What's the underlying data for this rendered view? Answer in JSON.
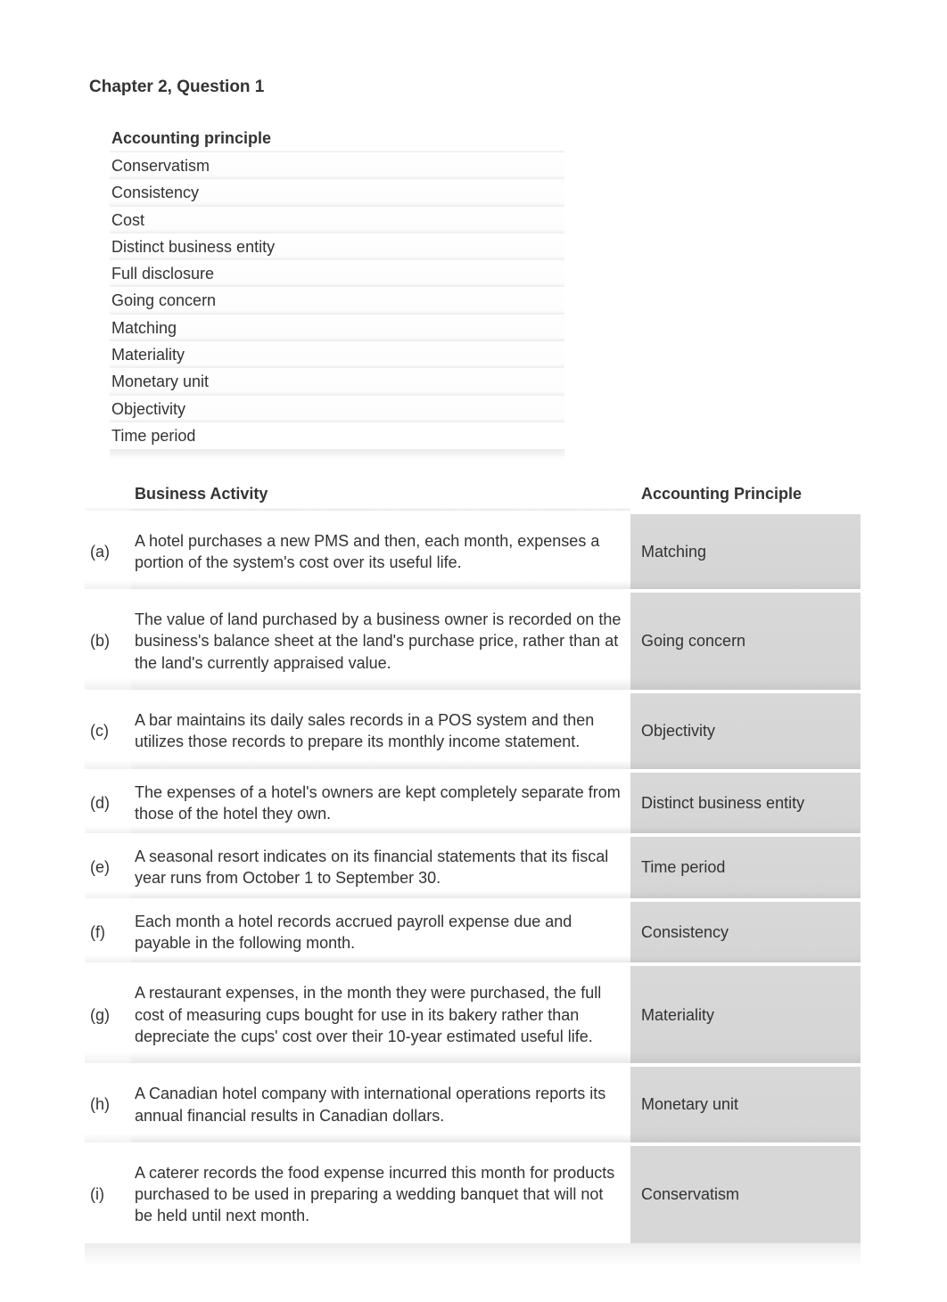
{
  "page_title": "Chapter 2, Question 1",
  "principles": {
    "header": "Accounting principle",
    "items": [
      "Conservatism",
      "Consistency",
      "Cost",
      "Distinct business entity",
      "Full disclosure",
      "Going concern",
      "Matching",
      "Materiality",
      "Monetary unit",
      "Objectivity",
      "Time period"
    ]
  },
  "table": {
    "header_activity": "Business Activity",
    "header_principle": "Accounting Principle",
    "rows": [
      {
        "label": "(a)",
        "activity": "A hotel purchases a new PMS and then, each month, expenses a portion of the system's cost over its useful life.",
        "principle": "Matching"
      },
      {
        "label": "(b)",
        "activity": "The value of land purchased by a business owner is recorded on the business's balance sheet at the land's purchase price, rather than at the land's currently appraised value.",
        "principle": "Going concern"
      },
      {
        "label": "(c)",
        "activity": "A bar maintains its daily sales records in a POS system and then utilizes those records to prepare its monthly income statement.",
        "principle": "Objectivity"
      },
      {
        "label": "(d)",
        "activity": "The expenses of a hotel's owners are kept completely separate from those of the hotel they own.",
        "principle": "Distinct business entity"
      },
      {
        "label": "(e)",
        "activity": "A seasonal resort indicates on its financial statements that its fiscal year runs from October 1 to September 30.",
        "principle": "Time period"
      },
      {
        "label": "(f)",
        "activity": "Each month a hotel records accrued payroll expense due and payable in the following month.",
        "principle": "Consistency"
      },
      {
        "label": "(g)",
        "activity": "A restaurant expenses, in the month they were purchased, the full cost of measuring cups bought for use in its bakery rather than depreciate the cups' cost over their 10-year estimated useful life.",
        "principle": "Materiality"
      },
      {
        "label": "(h)",
        "activity": "A Canadian hotel company with international operations reports its annual financial results in Canadian dollars.",
        "principle": "Monetary unit"
      },
      {
        "label": "(i)",
        "activity": "A caterer records the food expense incurred this month for products purchased to be used in preparing a wedding banquet that will not be held until next month.",
        "principle": "Conservatism"
      }
    ]
  }
}
